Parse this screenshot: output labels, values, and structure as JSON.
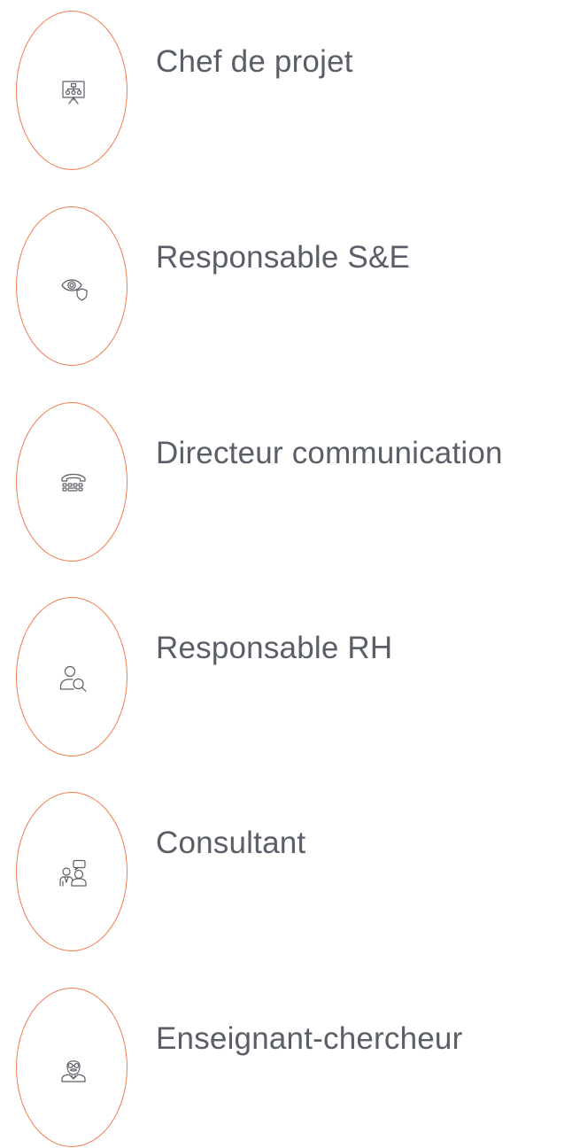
{
  "accent_color": "#f27a4e",
  "text_color": "#5a5e66",
  "roles": [
    {
      "label": "Chef de projet",
      "icon": "presentation-org-chart-icon"
    },
    {
      "label": "Responsable S&E",
      "icon": "eye-shield-icon"
    },
    {
      "label": "Directeur communication",
      "icon": "telephone-icon"
    },
    {
      "label": "Responsable RH",
      "icon": "user-search-icon"
    },
    {
      "label": "Consultant",
      "icon": "consultant-chat-icon"
    },
    {
      "label": "Enseignant-chercheur",
      "icon": "professor-icon"
    }
  ]
}
